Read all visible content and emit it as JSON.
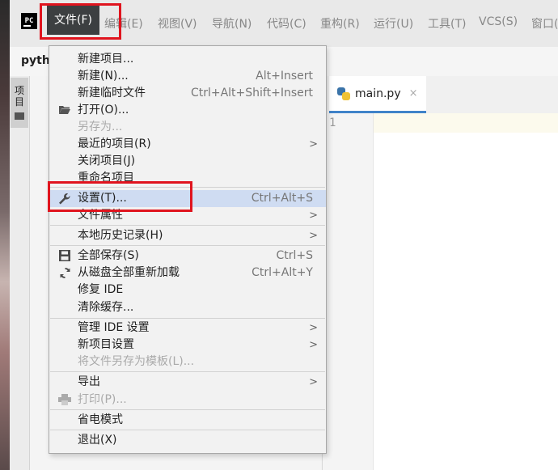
{
  "menubar": {
    "logo_text": "PC",
    "menus": [
      {
        "label": "文件(F)"
      },
      {
        "label": "编辑(E)"
      },
      {
        "label": "视图(V)"
      },
      {
        "label": "导航(N)"
      },
      {
        "label": "代码(C)"
      },
      {
        "label": "重构(R)"
      },
      {
        "label": "运行(U)"
      },
      {
        "label": "工具(T)"
      },
      {
        "label": "VCS(S)"
      },
      {
        "label": "窗口("
      }
    ]
  },
  "titlebar": {
    "project_name": "pyth"
  },
  "toolstrip": {
    "project_tab_label": "项目"
  },
  "editor": {
    "tab": {
      "label": "main.py",
      "close": "×"
    },
    "line_number": "1"
  },
  "file_menu": {
    "items": [
      {
        "label": "新建项目...",
        "shortcut": ""
      },
      {
        "label": "新建(N)...",
        "shortcut": "Alt+Insert"
      },
      {
        "label": "新建临时文件",
        "shortcut": "Ctrl+Alt+Shift+Insert"
      },
      {
        "label": "打开(O)...",
        "shortcut": "",
        "icon": "folder-open-icon"
      },
      {
        "label": "另存为...",
        "shortcut": "",
        "disabled": true
      },
      {
        "label": "最近的项目(R)",
        "shortcut": "",
        "submenu": true
      },
      {
        "label": "关闭项目(J)",
        "shortcut": ""
      },
      {
        "label": "重命名项目",
        "shortcut": ""
      },
      {
        "label": "设置(T)...",
        "shortcut": "Ctrl+Alt+S",
        "icon": "wrench-icon",
        "selected": true
      },
      {
        "label": "文件属性",
        "shortcut": "",
        "submenu": true
      },
      {
        "label": "本地历史记录(H)",
        "shortcut": "",
        "submenu": true
      },
      {
        "label": "全部保存(S)",
        "shortcut": "Ctrl+S",
        "icon": "save-icon"
      },
      {
        "label": "从磁盘全部重新加载",
        "shortcut": "Ctrl+Alt+Y",
        "icon": "reload-icon"
      },
      {
        "label": "修复 IDE",
        "shortcut": ""
      },
      {
        "label": "清除缓存...",
        "shortcut": ""
      },
      {
        "label": "管理 IDE 设置",
        "shortcut": "",
        "submenu": true
      },
      {
        "label": "新项目设置",
        "shortcut": "",
        "submenu": true
      },
      {
        "label": "将文件另存为模板(L)...",
        "shortcut": "",
        "disabled": true
      },
      {
        "label": "导出",
        "shortcut": "",
        "submenu": true
      },
      {
        "label": "打印(P)...",
        "shortcut": "",
        "icon": "print-icon",
        "disabled": true
      },
      {
        "label": "省电模式",
        "shortcut": ""
      },
      {
        "label": "退出(X)",
        "shortcut": ""
      }
    ],
    "submenu_glyph": ">"
  },
  "colors": {
    "highlight": "#e0141e",
    "selected_item": "#cfdcf2",
    "active_menu": "#3c3f41"
  }
}
